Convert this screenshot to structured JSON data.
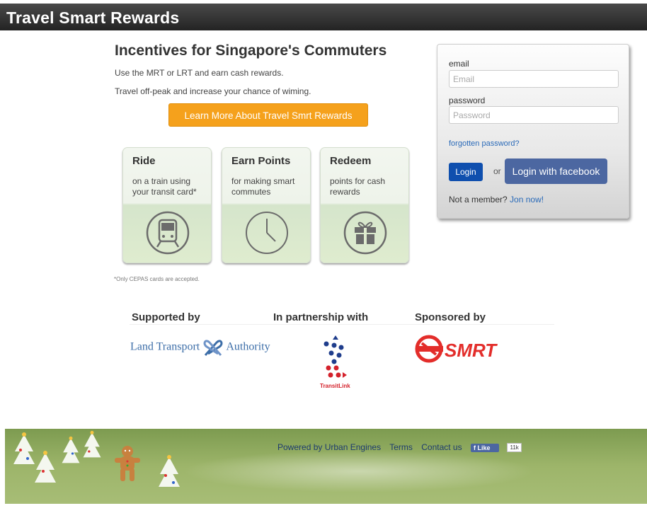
{
  "header": {
    "title": "Travel Smart Rewards"
  },
  "hero": {
    "title": "Incentives for Singapore's Commuters",
    "line1": "Use the MRT or LRT and earn cash rewards.",
    "line2": "Travel off-peak and increase your chance of wiming.",
    "cta_label": "Learn More About Travel Smrt Rewards"
  },
  "cards": [
    {
      "title": "Ride",
      "desc": "on a train using your transit card*",
      "icon": "train-icon"
    },
    {
      "title": "Earn Points",
      "desc": "for making smart commutes",
      "icon": "clock-icon"
    },
    {
      "title": "Redeem",
      "desc": "points for cash rewards",
      "icon": "gift-icon"
    }
  ],
  "note": "*Only CEPAS cards are accepted.",
  "login": {
    "email_label": "email",
    "email_placeholder": "Email",
    "password_label": "password",
    "password_placeholder": "Password",
    "forgot": "forgotten password?",
    "login_button": "Login",
    "or": "or",
    "facebook_button": "Login with facebook",
    "member_text": "Not a member?",
    "join_link": "Jon now!"
  },
  "sponsors": {
    "supported_by": "Supported by",
    "partnership": "In partnership with",
    "sponsored_by": "Sponsored by",
    "lta_left": "Land Transport",
    "lta_right": "Authority",
    "transitlink": "TransitLink",
    "smrt": "SMRT"
  },
  "footer": {
    "powered": "Powered by Urban Engines",
    "terms": "Terms",
    "contact": "Contact us",
    "like": "Like",
    "like_count": "11k"
  },
  "colors": {
    "accent_orange": "#f5a11c",
    "login_blue": "#0f4fae",
    "facebook_blue": "#4c67a1",
    "link_blue": "#2a6ab8",
    "footer_green": "#9db56a"
  }
}
